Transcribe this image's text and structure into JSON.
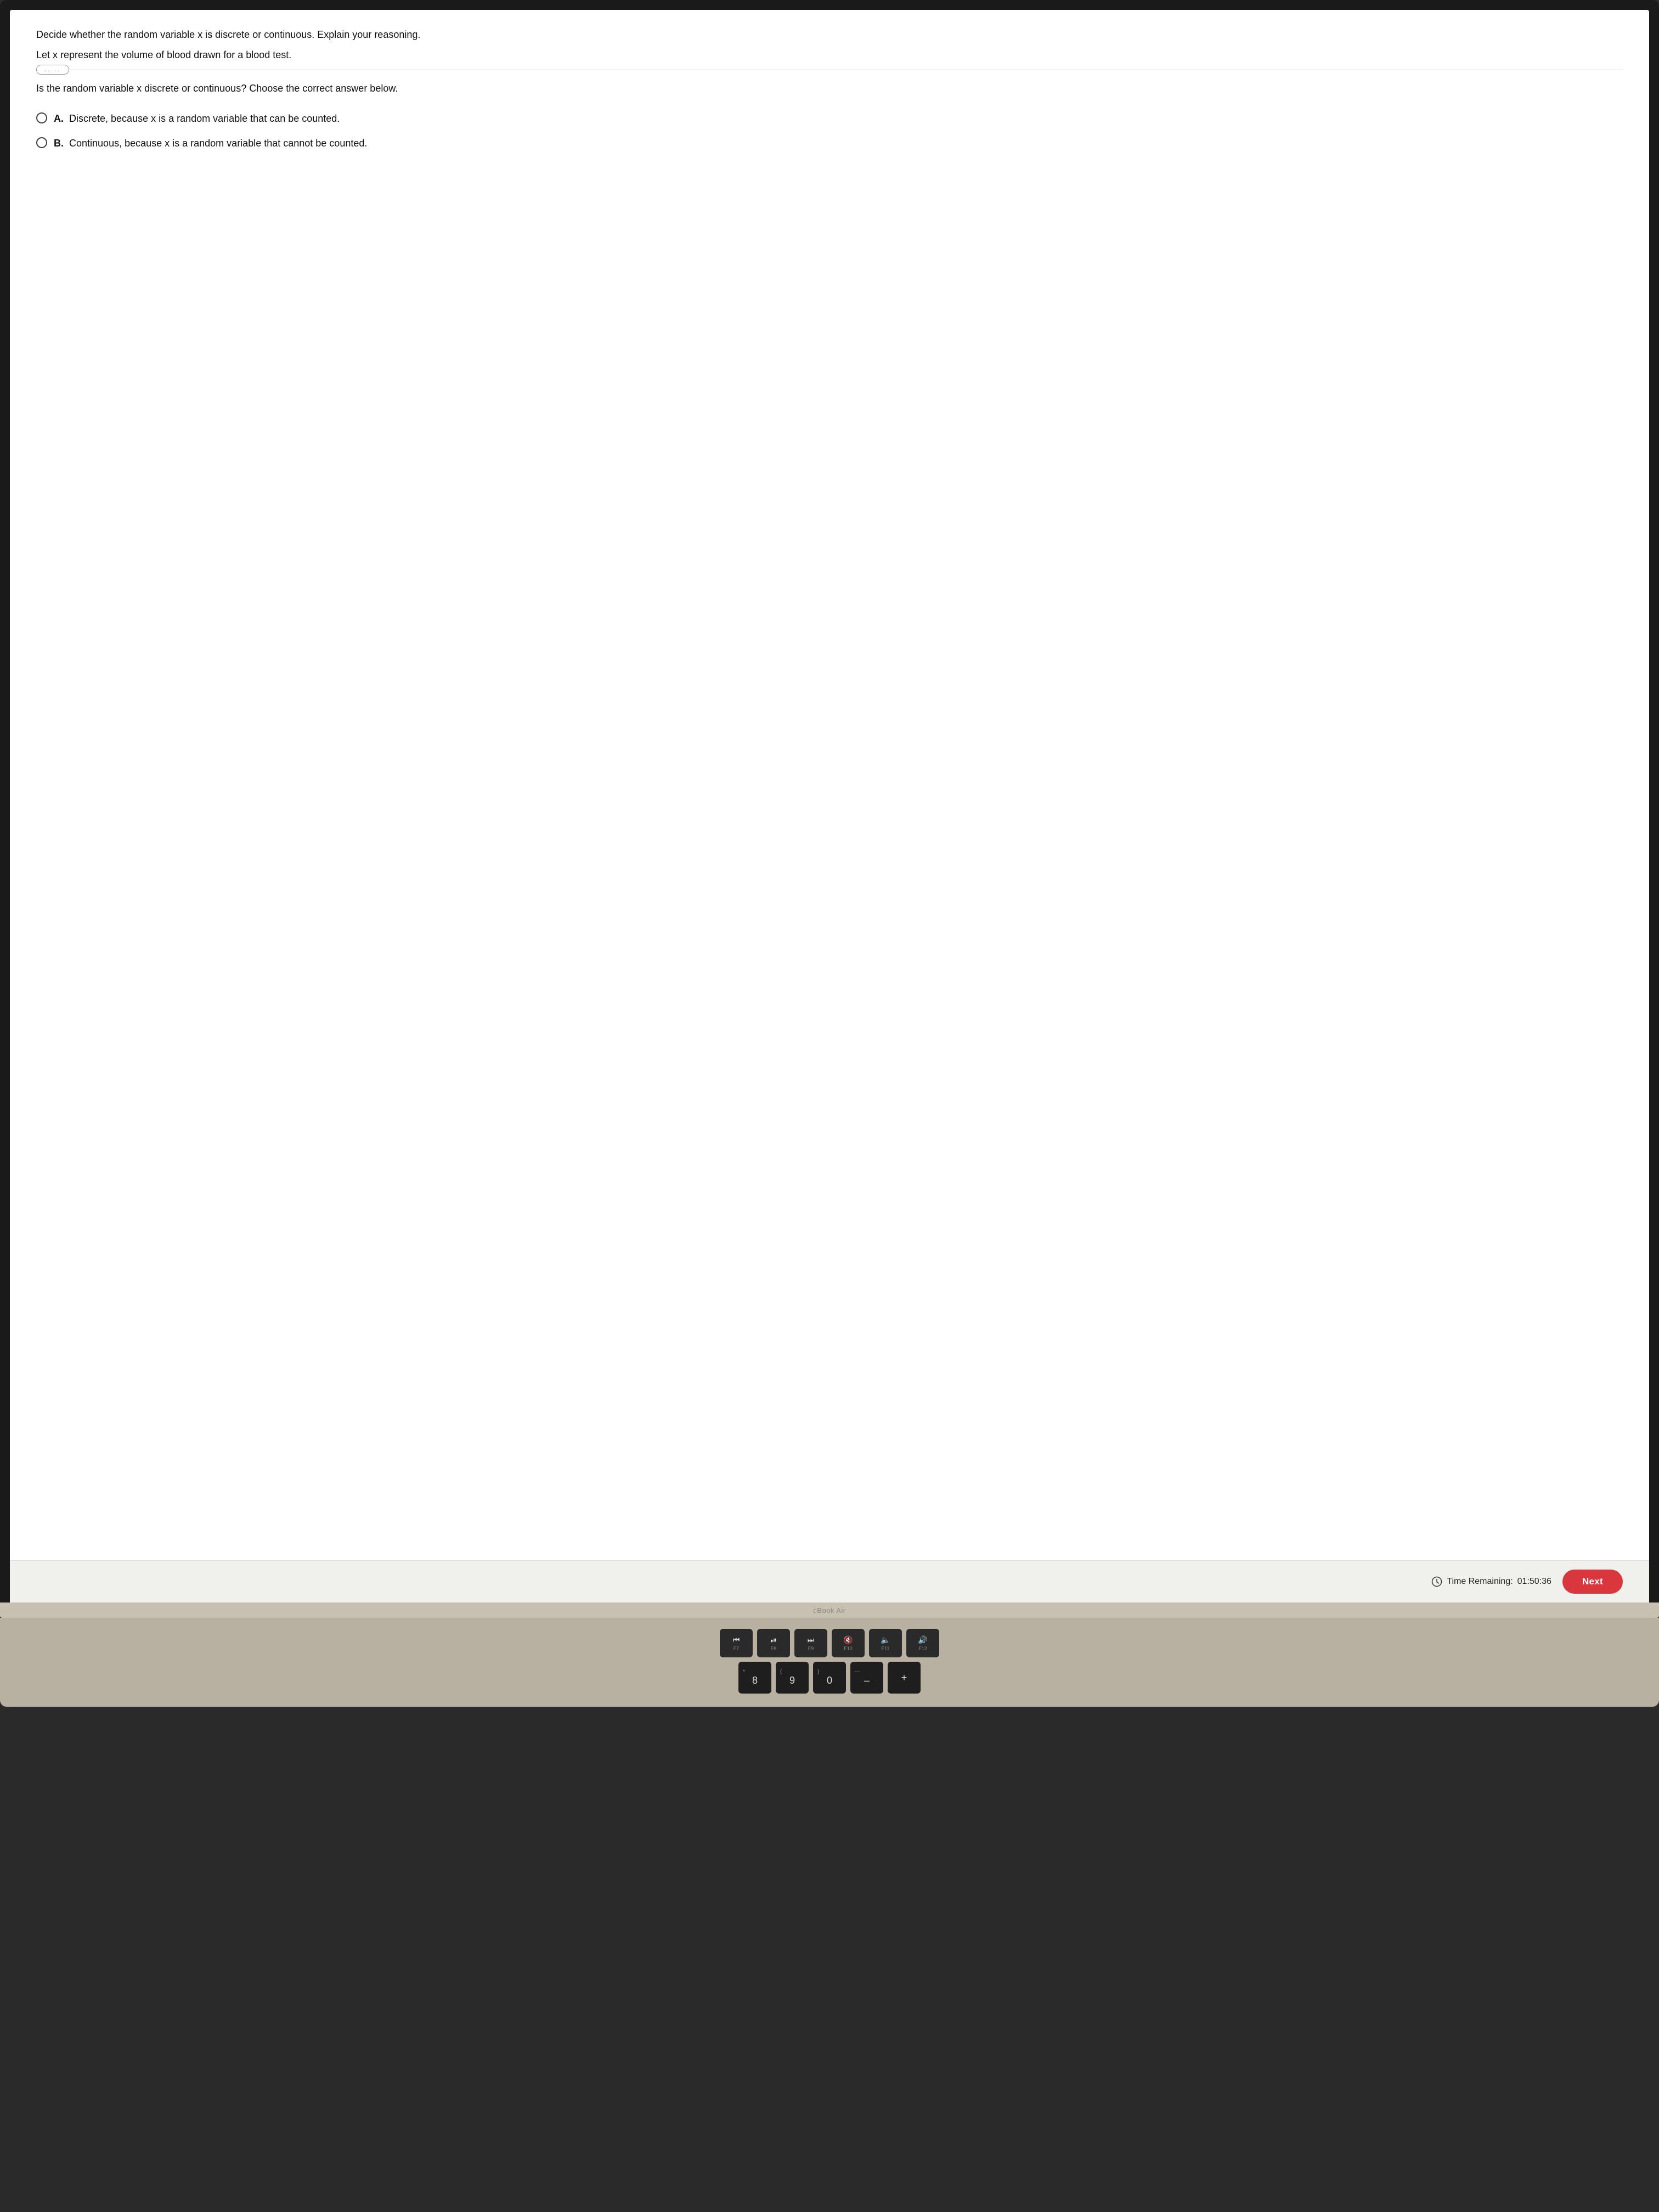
{
  "content": {
    "instruction": "Decide whether the random variable x is discrete or continuous. Explain your reasoning.",
    "setup": "Let x represent the volume of blood drawn for a blood test.",
    "divider_dots": ".....",
    "prompt": "Is the random variable x discrete or continuous? Choose the correct answer below.",
    "options": [
      {
        "id": "A",
        "label": "A.",
        "text": "Discrete, because x is a random variable that can be counted."
      },
      {
        "id": "B",
        "label": "B.",
        "text": "Continuous, because x is a random variable that cannot be counted."
      }
    ]
  },
  "footer": {
    "time_label": "Time Remaining:",
    "time_value": "01:50:36",
    "next_button": "Next"
  },
  "laptop": {
    "brand": "cBook Air"
  },
  "keyboard": {
    "fn_row": [
      {
        "icon": "⏮",
        "label": "F7"
      },
      {
        "icon": "⏯",
        "label": "F8"
      },
      {
        "icon": "⏭",
        "label": "F9"
      },
      {
        "icon": "🔇",
        "label": "F10"
      },
      {
        "icon": "🔈",
        "label": "F11"
      },
      {
        "icon": "🔊",
        "label": "F12"
      }
    ],
    "num_row": [
      {
        "top": "*",
        "bottom": "8"
      },
      {
        "top": "(",
        "bottom": "9"
      },
      {
        "top": ")",
        "bottom": "0"
      },
      {
        "top": "—",
        "bottom": "–"
      },
      {
        "top": "",
        "bottom": "+"
      }
    ]
  }
}
